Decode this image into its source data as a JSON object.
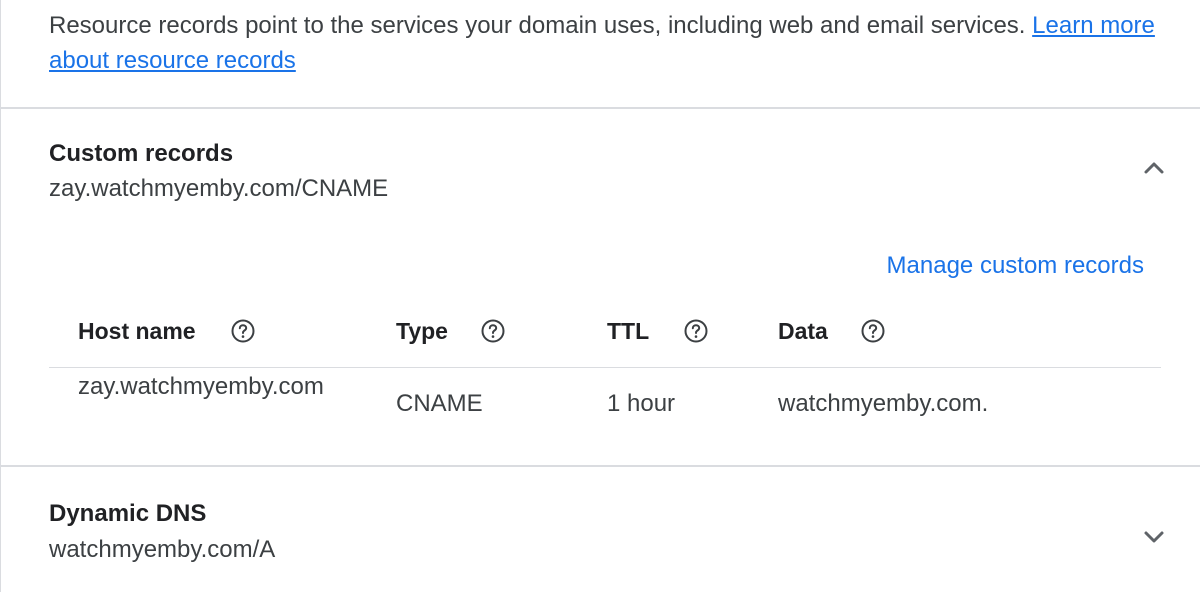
{
  "intro": {
    "text": "Resource records point to the services your domain uses, including web and email services. ",
    "link": "Learn more about resource records"
  },
  "custom_records": {
    "title": "Custom records",
    "subtitle": "zay.watchmyemby.com/CNAME",
    "expand_icon": "chevron-up-icon",
    "manage_link": "Manage custom records",
    "columns": [
      {
        "label": "Host name",
        "help_icon": "help-circle-icon"
      },
      {
        "label": "Type",
        "help_icon": "help-circle-icon"
      },
      {
        "label": "TTL",
        "help_icon": "help-circle-icon"
      },
      {
        "label": "Data",
        "help_icon": "help-circle-icon"
      }
    ],
    "rows": [
      {
        "host": "zay.watchmyemby.com",
        "type": "CNAME",
        "ttl": "1 hour",
        "data": "watchmyemby.com."
      }
    ]
  },
  "dynamic_dns": {
    "title": "Dynamic DNS",
    "subtitle": "watchmyemby.com/A",
    "expand_icon": "chevron-down-icon"
  },
  "colors": {
    "link": "#1a73e8",
    "divider": "#dadce0",
    "text": "#202124",
    "secondary_text": "#3c4043"
  }
}
